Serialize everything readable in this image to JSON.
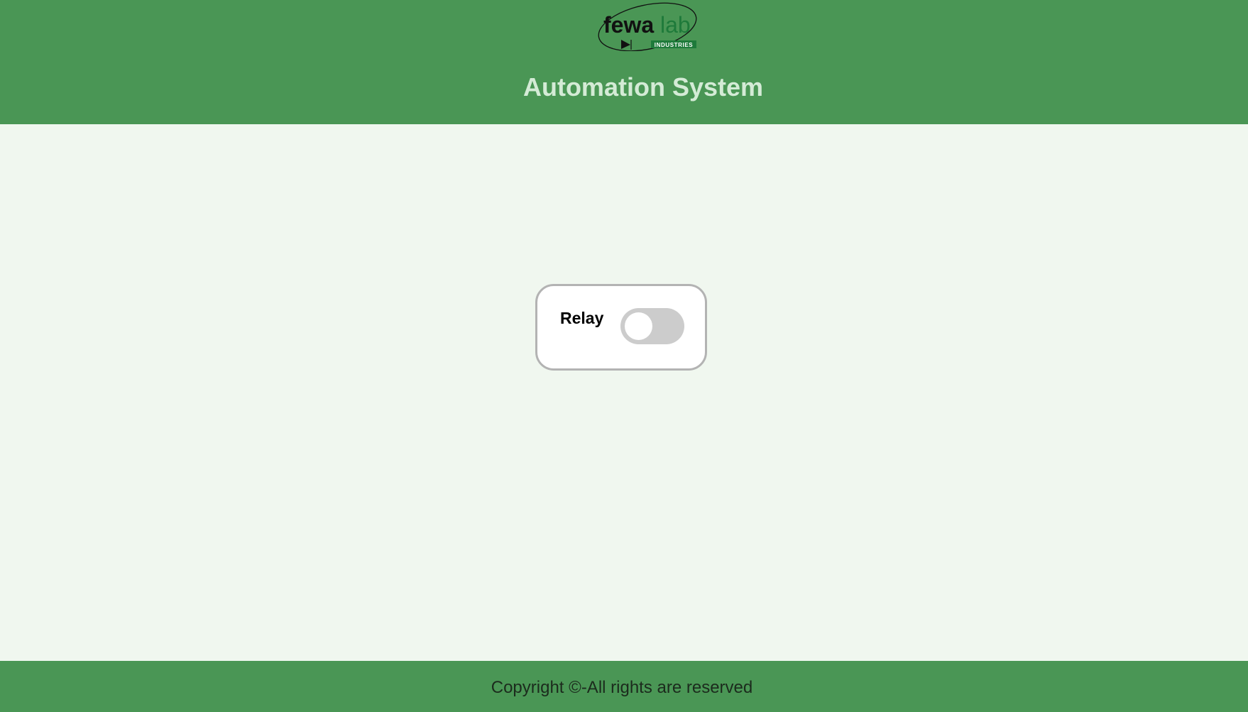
{
  "header": {
    "logo": {
      "brand_dark": "fewa",
      "brand_light": "lab",
      "sub": "INDUSTRIES",
      "dark_color": "#111111",
      "green_color": "#1e7a3a"
    },
    "title": "Automation System"
  },
  "card": {
    "label": "Relay",
    "toggle_state": "off"
  },
  "footer": {
    "text": "Copyright ©-All rights are reserved"
  },
  "colors": {
    "header_bg": "#4a9655",
    "body_bg": "#f0f7ef",
    "title_color": "#d4ebd6",
    "toggle_off": "#cccccc"
  }
}
